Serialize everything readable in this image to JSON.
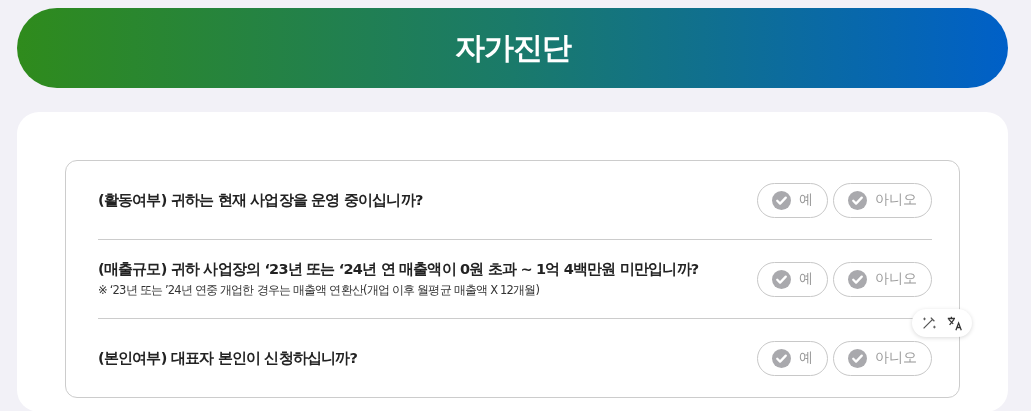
{
  "header": {
    "title": "자가진단"
  },
  "questions": [
    {
      "text": "(활동여부) 귀하는 현재 사업장을 운영 중이십니까?",
      "options": [
        {
          "label": "예",
          "selected": false
        },
        {
          "label": "아니오",
          "selected": false
        }
      ]
    },
    {
      "text": "(매출규모) 귀하 사업장의 ‘23년 또는 ‘24년 연 매출액이 0원 초과 ~ 1억 4백만원 미만입니까?",
      "note": "※ ‘23년 또는 ’24년 연중 개업한 경우는 매출액 연환산(개업 이후 월평균 매출액 X 12개월)",
      "options": [
        {
          "label": "예",
          "selected": false
        },
        {
          "label": "아니오",
          "selected": false
        }
      ]
    },
    {
      "text": "(본인여부) 대표자 본인이 신청하십니까?",
      "options": [
        {
          "label": "예",
          "selected": false
        },
        {
          "label": "아니오",
          "selected": false
        }
      ]
    }
  ]
}
